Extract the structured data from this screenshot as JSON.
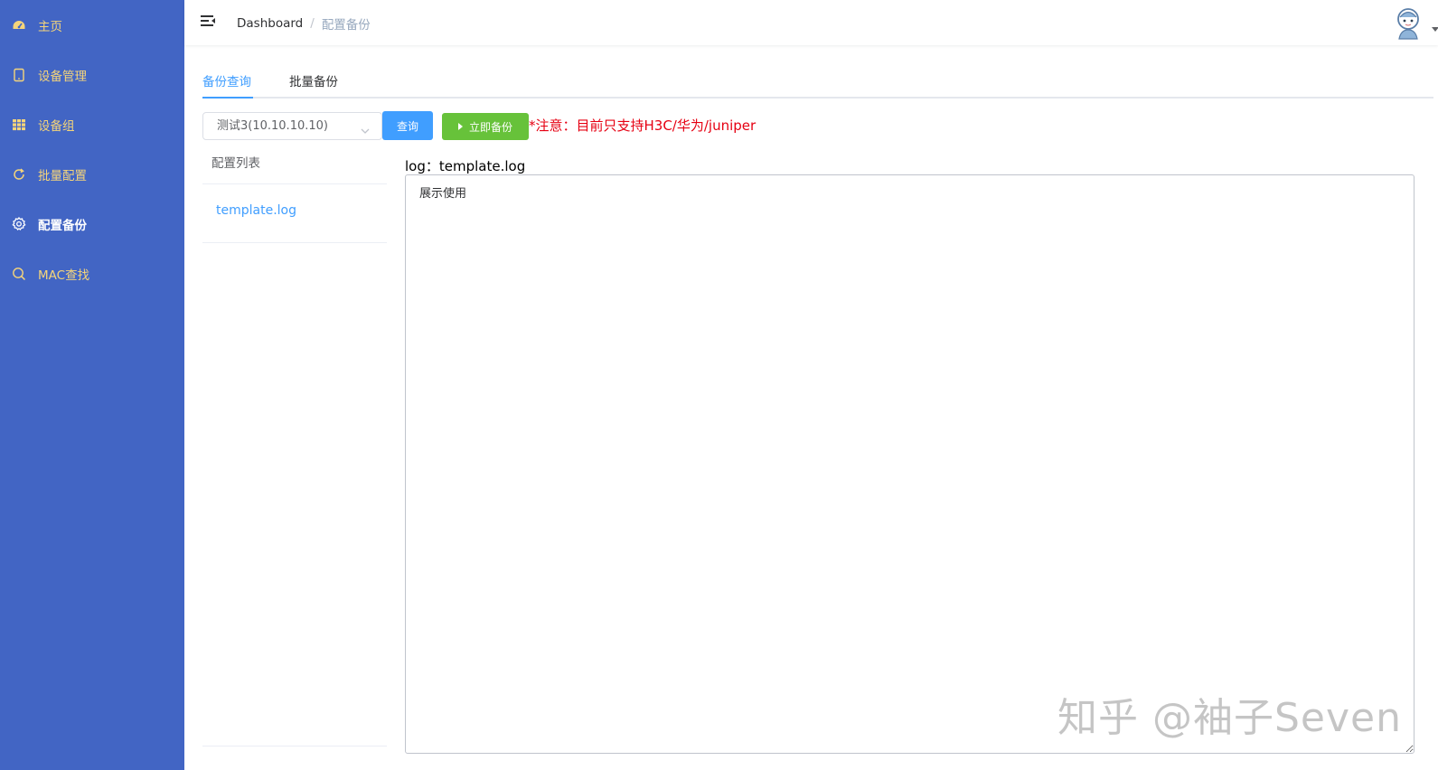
{
  "sidebar": {
    "items": [
      {
        "label": "主页",
        "icon": "dashboard-icon",
        "active": false
      },
      {
        "label": "设备管理",
        "icon": "tablet-icon",
        "active": false
      },
      {
        "label": "设备组",
        "icon": "grid-icon",
        "active": false
      },
      {
        "label": "批量配置",
        "icon": "refresh-icon",
        "active": false
      },
      {
        "label": "配置备份",
        "icon": "gear-icon",
        "active": true
      },
      {
        "label": "MAC查找",
        "icon": "search-icon",
        "active": false
      }
    ],
    "colors": {
      "background": "#4265c4",
      "text": "#f5d57a",
      "active_text": "#ffffff"
    }
  },
  "header": {
    "breadcrumb": {
      "home": "Dashboard",
      "separator": "/",
      "current": "配置备份"
    }
  },
  "tabs": [
    {
      "label": "备份查询",
      "active": true
    },
    {
      "label": "批量备份",
      "active": false
    }
  ],
  "toolbar": {
    "device_select_value": "测试3(10.10.10.10)",
    "query_label": "查询",
    "backup_label": "立即备份",
    "notice": "*注意：目前只支持H3C/华为/juniper"
  },
  "config_list": {
    "title": "配置列表",
    "items": [
      "template.log"
    ]
  },
  "log": {
    "label": "log：template.log",
    "content": "展示使用"
  },
  "watermark": "知乎 @袖子Seven",
  "accent_colors": {
    "primary": "#409eff",
    "success": "#67c23a",
    "danger": "#e60012"
  }
}
